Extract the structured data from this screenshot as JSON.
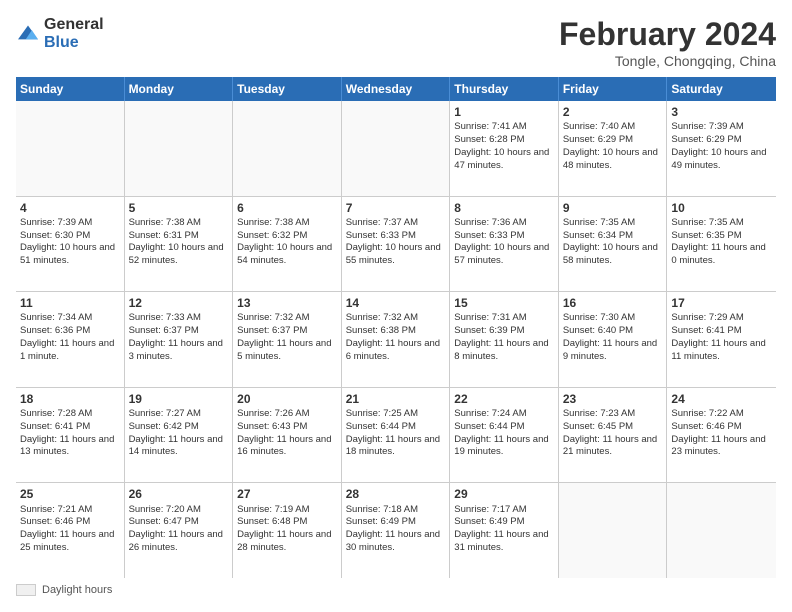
{
  "header": {
    "logo_line1": "General",
    "logo_line2": "Blue",
    "month_title": "February 2024",
    "location": "Tongle, Chongqing, China"
  },
  "days_of_week": [
    "Sunday",
    "Monday",
    "Tuesday",
    "Wednesday",
    "Thursday",
    "Friday",
    "Saturday"
  ],
  "weeks": [
    [
      {
        "day": "",
        "info": ""
      },
      {
        "day": "",
        "info": ""
      },
      {
        "day": "",
        "info": ""
      },
      {
        "day": "",
        "info": ""
      },
      {
        "day": "1",
        "info": "Sunrise: 7:41 AM\nSunset: 6:28 PM\nDaylight: 10 hours and 47 minutes."
      },
      {
        "day": "2",
        "info": "Sunrise: 7:40 AM\nSunset: 6:29 PM\nDaylight: 10 hours and 48 minutes."
      },
      {
        "day": "3",
        "info": "Sunrise: 7:39 AM\nSunset: 6:29 PM\nDaylight: 10 hours and 49 minutes."
      }
    ],
    [
      {
        "day": "4",
        "info": "Sunrise: 7:39 AM\nSunset: 6:30 PM\nDaylight: 10 hours and 51 minutes."
      },
      {
        "day": "5",
        "info": "Sunrise: 7:38 AM\nSunset: 6:31 PM\nDaylight: 10 hours and 52 minutes."
      },
      {
        "day": "6",
        "info": "Sunrise: 7:38 AM\nSunset: 6:32 PM\nDaylight: 10 hours and 54 minutes."
      },
      {
        "day": "7",
        "info": "Sunrise: 7:37 AM\nSunset: 6:33 PM\nDaylight: 10 hours and 55 minutes."
      },
      {
        "day": "8",
        "info": "Sunrise: 7:36 AM\nSunset: 6:33 PM\nDaylight: 10 hours and 57 minutes."
      },
      {
        "day": "9",
        "info": "Sunrise: 7:35 AM\nSunset: 6:34 PM\nDaylight: 10 hours and 58 minutes."
      },
      {
        "day": "10",
        "info": "Sunrise: 7:35 AM\nSunset: 6:35 PM\nDaylight: 11 hours and 0 minutes."
      }
    ],
    [
      {
        "day": "11",
        "info": "Sunrise: 7:34 AM\nSunset: 6:36 PM\nDaylight: 11 hours and 1 minute."
      },
      {
        "day": "12",
        "info": "Sunrise: 7:33 AM\nSunset: 6:37 PM\nDaylight: 11 hours and 3 minutes."
      },
      {
        "day": "13",
        "info": "Sunrise: 7:32 AM\nSunset: 6:37 PM\nDaylight: 11 hours and 5 minutes."
      },
      {
        "day": "14",
        "info": "Sunrise: 7:32 AM\nSunset: 6:38 PM\nDaylight: 11 hours and 6 minutes."
      },
      {
        "day": "15",
        "info": "Sunrise: 7:31 AM\nSunset: 6:39 PM\nDaylight: 11 hours and 8 minutes."
      },
      {
        "day": "16",
        "info": "Sunrise: 7:30 AM\nSunset: 6:40 PM\nDaylight: 11 hours and 9 minutes."
      },
      {
        "day": "17",
        "info": "Sunrise: 7:29 AM\nSunset: 6:41 PM\nDaylight: 11 hours and 11 minutes."
      }
    ],
    [
      {
        "day": "18",
        "info": "Sunrise: 7:28 AM\nSunset: 6:41 PM\nDaylight: 11 hours and 13 minutes."
      },
      {
        "day": "19",
        "info": "Sunrise: 7:27 AM\nSunset: 6:42 PM\nDaylight: 11 hours and 14 minutes."
      },
      {
        "day": "20",
        "info": "Sunrise: 7:26 AM\nSunset: 6:43 PM\nDaylight: 11 hours and 16 minutes."
      },
      {
        "day": "21",
        "info": "Sunrise: 7:25 AM\nSunset: 6:44 PM\nDaylight: 11 hours and 18 minutes."
      },
      {
        "day": "22",
        "info": "Sunrise: 7:24 AM\nSunset: 6:44 PM\nDaylight: 11 hours and 19 minutes."
      },
      {
        "day": "23",
        "info": "Sunrise: 7:23 AM\nSunset: 6:45 PM\nDaylight: 11 hours and 21 minutes."
      },
      {
        "day": "24",
        "info": "Sunrise: 7:22 AM\nSunset: 6:46 PM\nDaylight: 11 hours and 23 minutes."
      }
    ],
    [
      {
        "day": "25",
        "info": "Sunrise: 7:21 AM\nSunset: 6:46 PM\nDaylight: 11 hours and 25 minutes."
      },
      {
        "day": "26",
        "info": "Sunrise: 7:20 AM\nSunset: 6:47 PM\nDaylight: 11 hours and 26 minutes."
      },
      {
        "day": "27",
        "info": "Sunrise: 7:19 AM\nSunset: 6:48 PM\nDaylight: 11 hours and 28 minutes."
      },
      {
        "day": "28",
        "info": "Sunrise: 7:18 AM\nSunset: 6:49 PM\nDaylight: 11 hours and 30 minutes."
      },
      {
        "day": "29",
        "info": "Sunrise: 7:17 AM\nSunset: 6:49 PM\nDaylight: 11 hours and 31 minutes."
      },
      {
        "day": "",
        "info": ""
      },
      {
        "day": "",
        "info": ""
      }
    ]
  ],
  "footer": {
    "daylight_label": "Daylight hours"
  }
}
